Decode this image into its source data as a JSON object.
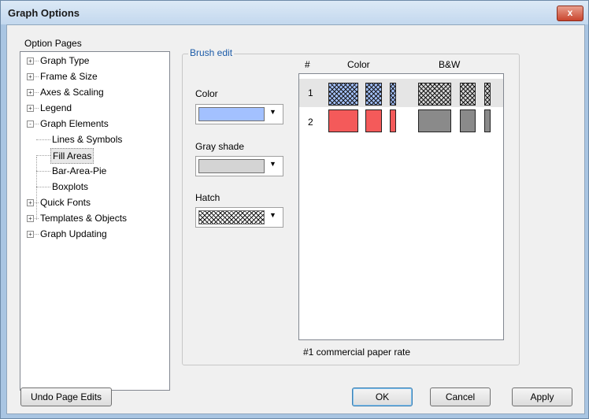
{
  "window": {
    "title": "Graph Options",
    "close_glyph": "x"
  },
  "tree": {
    "label": "Option Pages",
    "items": [
      {
        "label": "Graph Type",
        "expander": "+"
      },
      {
        "label": "Frame & Size",
        "expander": "+"
      },
      {
        "label": "Axes & Scaling",
        "expander": "+"
      },
      {
        "label": "Legend",
        "expander": "+"
      },
      {
        "label": "Graph Elements",
        "expander": "-"
      },
      {
        "label": "Lines & Symbols"
      },
      {
        "label": "Fill Areas",
        "selected": true
      },
      {
        "label": "Bar-Area-Pie"
      },
      {
        "label": "Boxplots"
      },
      {
        "label": "Quick Fonts",
        "expander": "+"
      },
      {
        "label": "Templates & Objects",
        "expander": "+"
      },
      {
        "label": "Graph Updating",
        "expander": "+"
      }
    ]
  },
  "brush_edit": {
    "title": "Brush edit",
    "color_label": "Color",
    "gray_shade_label": "Gray shade",
    "hatch_label": "Hatch",
    "color_value": "#a3c1ff",
    "gray_value": "#d4d4d4"
  },
  "preview": {
    "col_num": "#",
    "col_color": "Color",
    "col_bw": "B&W",
    "rows": [
      {
        "num": "1",
        "pattern": "crosshatch"
      },
      {
        "num": "2",
        "pattern": "solid"
      }
    ],
    "caption": "#1  commercial paper rate"
  },
  "buttons": {
    "undo": "Undo Page Edits",
    "ok": "OK",
    "cancel": "Cancel",
    "apply": "Apply"
  },
  "colors": {
    "accent": "#1c5ba8",
    "series1_color": "#a3c1ff",
    "series2_color": "#f45a5a",
    "series2_bw": "#8a8a8a"
  },
  "icons": {
    "dropdown": "chevron-down-icon",
    "close": "close-icon",
    "expander": "tree-expander-icon"
  }
}
